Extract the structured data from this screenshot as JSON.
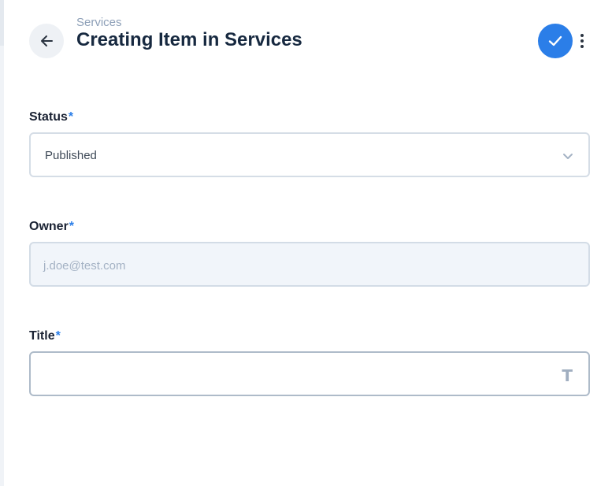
{
  "header": {
    "breadcrumb": "Services",
    "title": "Creating Item in Services"
  },
  "form": {
    "status": {
      "label": "Status",
      "required_mark": "*",
      "value": "Published"
    },
    "owner": {
      "label": "Owner",
      "required_mark": "*",
      "placeholder": "j.doe@test.com"
    },
    "title": {
      "label": "Title",
      "required_mark": "*",
      "value": "",
      "type_icon": "T"
    }
  },
  "colors": {
    "accent": "#2b7ee8",
    "text": "#172940",
    "muted": "#8ea0b8"
  },
  "icons": {
    "back": "arrow-left-icon",
    "save": "check-icon",
    "more": "more-vertical-icon",
    "dropdown": "chevron-down-icon",
    "text_type": "text-type-icon"
  }
}
